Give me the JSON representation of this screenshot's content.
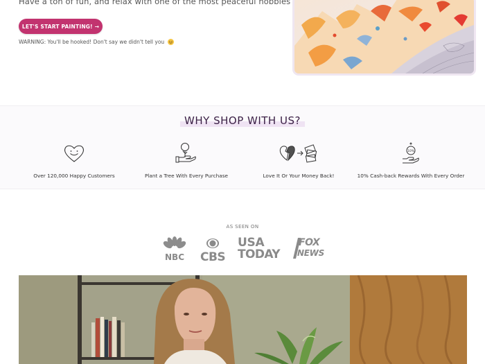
{
  "hero": {
    "text": "Have a ton of fun, and relax with one of the most peaceful hobbies out there!",
    "cta_label": "LET'S START PAINTING! →",
    "warning": "WARNING: You'll be hooked! Don't say we didn't tell you"
  },
  "why": {
    "title": "WHY SHOP WITH US?",
    "features": [
      {
        "icon": "heart-smile-icon",
        "label": "Over 120,000 Happy Customers"
      },
      {
        "icon": "tree-hand-icon",
        "label": "Plant a Tree With Every Purchase"
      },
      {
        "icon": "broken-heart-money-icon",
        "label": "Love It Or Your Money Back!"
      },
      {
        "icon": "cashback-coin-hand-icon",
        "label": "10% Cash-back Rewards With Every Order"
      }
    ]
  },
  "seen_on": {
    "label": "AS SEEN ON",
    "logos": {
      "nbc": "NBC",
      "cbs": "CBS",
      "usa": "USA",
      "today": "TODAY",
      "fox": "FOX",
      "news": "NEWS"
    }
  },
  "colors": {
    "accent": "#c2336f",
    "title": "#3a1f45",
    "logo_gray": "#888888"
  }
}
